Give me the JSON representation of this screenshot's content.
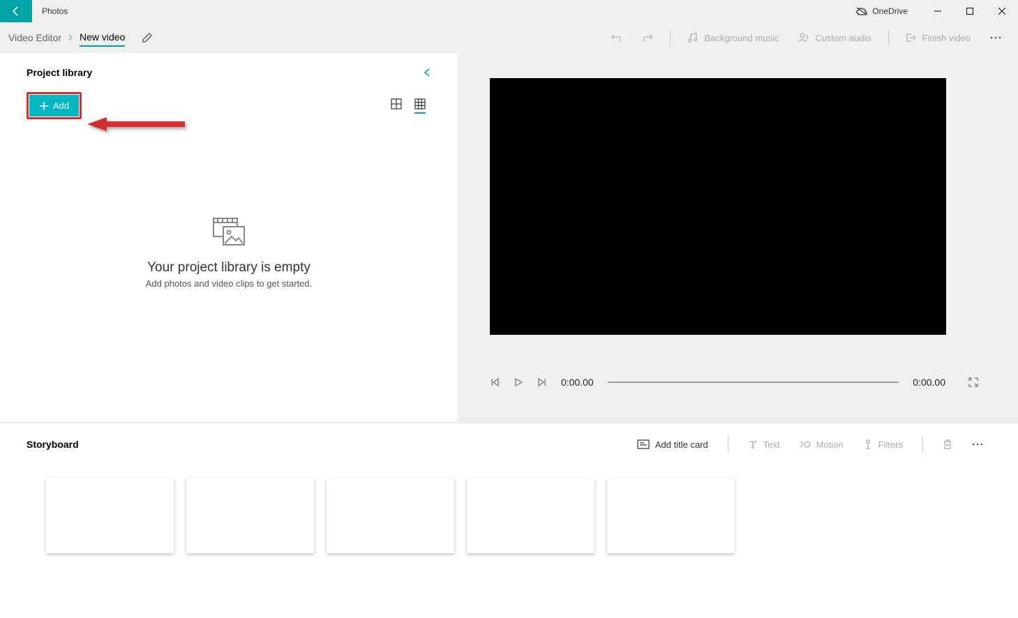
{
  "window": {
    "app_title": "Photos",
    "onedrive_label": "OneDrive"
  },
  "breadcrumb": {
    "root": "Video Editor",
    "current": "New video"
  },
  "toolbar": {
    "bg_music": "Background music",
    "custom_audio": "Custom audio",
    "finish_video": "Finish video"
  },
  "library": {
    "title": "Project library",
    "add_label": "Add",
    "empty_title": "Your project library is empty",
    "empty_sub": "Add photos and video clips to get started."
  },
  "player": {
    "time_current": "0:00.00",
    "time_total": "0:00.00"
  },
  "storyboard": {
    "title": "Storyboard",
    "add_title_card": "Add title card",
    "text": "Text",
    "motion": "Motion",
    "filters": "Filters"
  }
}
